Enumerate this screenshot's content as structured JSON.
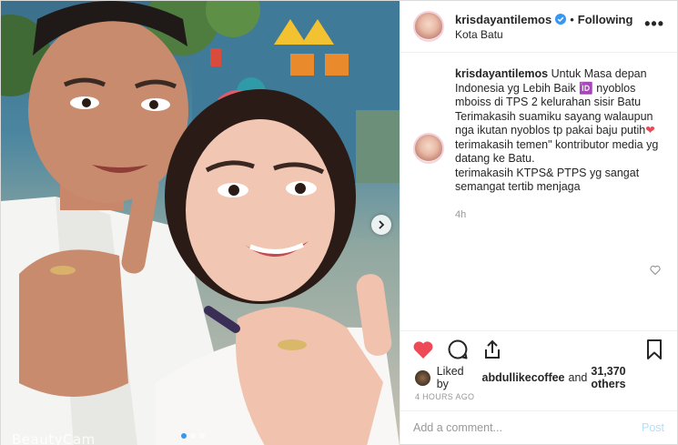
{
  "photo": {
    "watermark": "BeautyCam",
    "carousel_dots": 3,
    "active_dot": 0,
    "accent": "#3897f0"
  },
  "header": {
    "username": "krisdayantilemos",
    "separator": "•",
    "follow_status": "Following",
    "location": "Kota Batu",
    "more_label": "•••",
    "verified_color": "#3897f0"
  },
  "caption": {
    "username": "krisdayantilemos",
    "lines": [
      "Untuk Masa depan Indonesia yg Lebih Baik 🆔 nyoblos mboiss di TPS 2 kelurahan sisir Batu",
      "Terimakasih suamiku sayang walaupun nga ikutan nyoblos tp pakai baju putih",
      "terimakasih temen\" kontributor media yg datang ke Batu.",
      "terimakasih KTPS& PTPS yg sangat semangat tertib menjaga"
    ],
    "heart": "❤",
    "time_ago": "4h"
  },
  "actions": {
    "like_icon": "heart-filled-icon",
    "comment_icon": "comment-icon",
    "share_icon": "share-icon",
    "save_icon": "bookmark-icon",
    "like_color": "#ed4956"
  },
  "likes": {
    "prefix": "Liked by",
    "user": "abdullikecoffee",
    "and": "and",
    "others": "31,370 others"
  },
  "posted_ago": "4 HOURS AGO",
  "comment_box": {
    "placeholder": "Add a comment...",
    "post_label": "Post"
  }
}
